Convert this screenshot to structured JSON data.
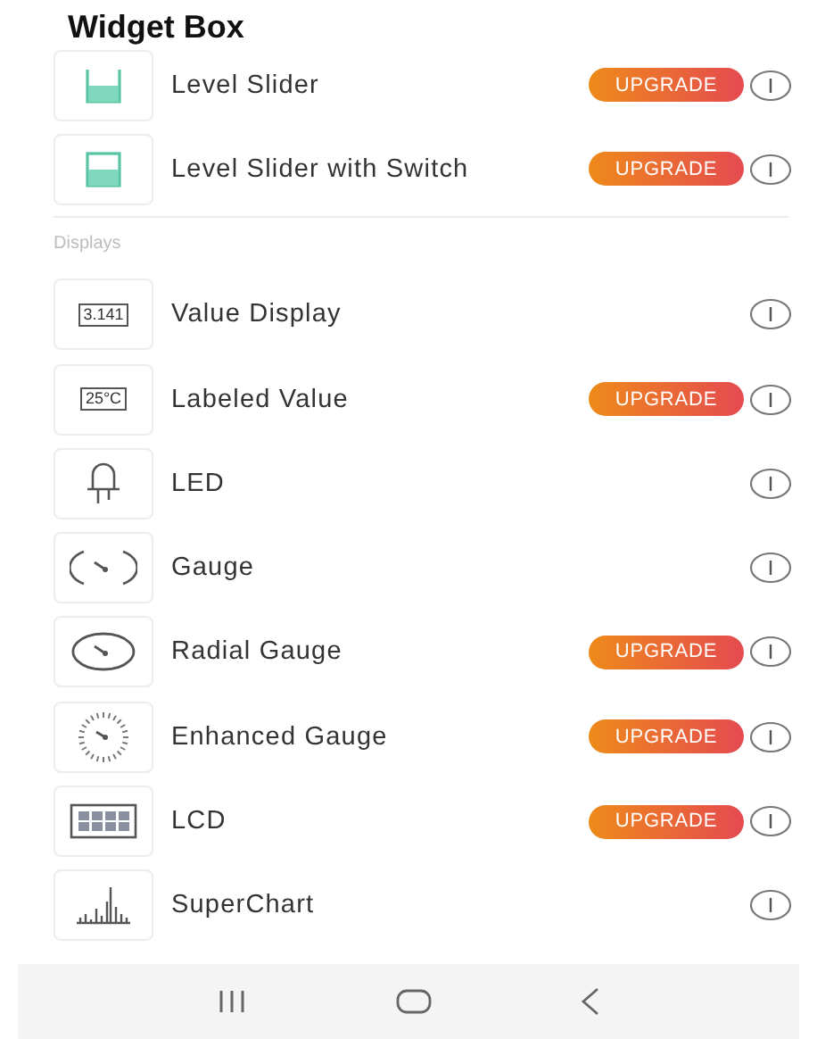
{
  "title": "Widget Box",
  "sections": [
    {
      "items": [
        {
          "name": "Level Slider",
          "kind": "slider",
          "badge": "UPGRADE"
        },
        {
          "name": "Level Slider with Switch",
          "kind": "slider-switch",
          "badge": "UPGRADE"
        }
      ]
    },
    {
      "header": "Displays",
      "items": [
        {
          "name": "Value Display",
          "kind": "value",
          "icon_text": "3.141"
        },
        {
          "name": "Labeled Value",
          "kind": "value",
          "icon_text": "25°C",
          "badge": "UPGRADE"
        },
        {
          "name": "LED",
          "kind": "led"
        },
        {
          "name": "Gauge",
          "kind": "gauge"
        },
        {
          "name": "Radial Gauge",
          "kind": "radial",
          "badge": "UPGRADE"
        },
        {
          "name": "Enhanced Gauge",
          "kind": "enhanced",
          "badge": "UPGRADE"
        },
        {
          "name": "LCD",
          "kind": "lcd",
          "badge": "UPGRADE"
        },
        {
          "name": "SuperChart",
          "kind": "chart"
        }
      ]
    }
  ]
}
